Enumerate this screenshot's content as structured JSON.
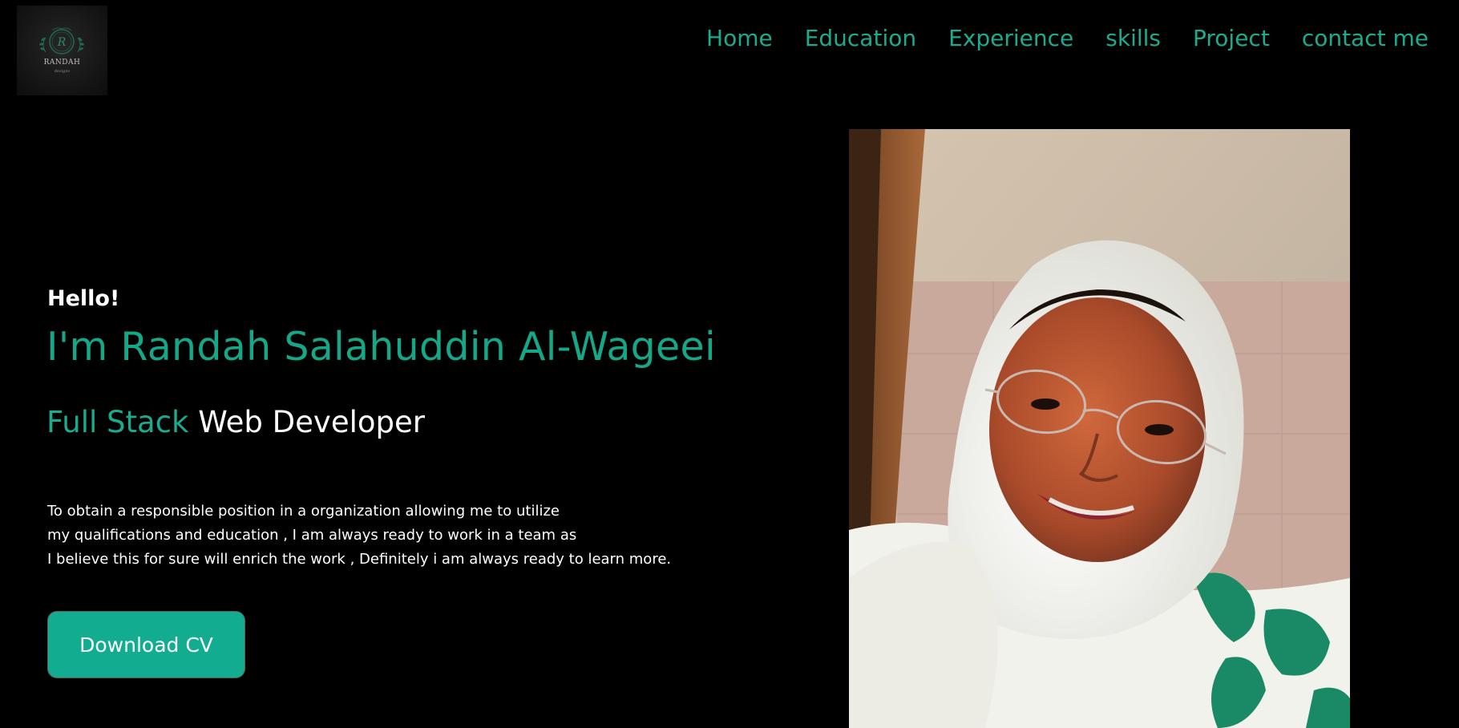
{
  "logo": {
    "icon": "monogram-laurel-icon",
    "text": "RANDAH",
    "subtext": "designs"
  },
  "nav": {
    "items": [
      {
        "label": "Home"
      },
      {
        "label": "Education"
      },
      {
        "label": "Experience"
      },
      {
        "label": "skills"
      },
      {
        "label": "Project"
      },
      {
        "label": "contact me"
      }
    ]
  },
  "hero": {
    "greeting": "Hello!",
    "name": "I'm Randah Salahuddin Al-Wageei",
    "role_accent": "Full Stack",
    "role_rest": "Web Developer",
    "bio_lines": [
      "To obtain a responsible position in a organization allowing me to utilize",
      "my qualifications and education , I am always ready to work in a team as",
      "I believe this for sure will enrich the work , Definitely i am always ready to learn more."
    ],
    "download_label": "Download CV"
  },
  "photo": {
    "alt": "portrait-photo"
  },
  "colors": {
    "background": "#000000",
    "accent": "#1bab8e",
    "button": "#12ad91",
    "text": "#ffffff"
  }
}
